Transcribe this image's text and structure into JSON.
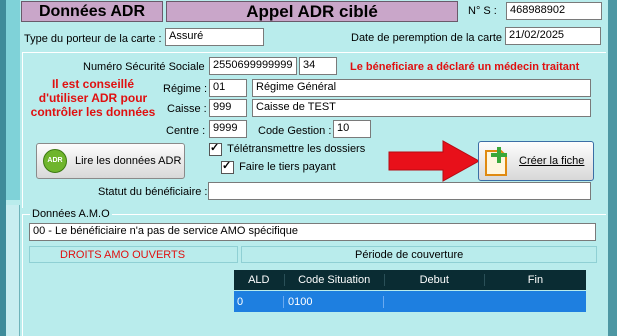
{
  "header": {
    "title_left": "Données ADR",
    "title_center": "Appel ADR ciblé",
    "ns_label": "N° S :",
    "ns_value": "468988902"
  },
  "card": {
    "type_label": "Type du porteur de la carte :",
    "type_value": "Assuré",
    "date_label": "Date de peremption de la carte :",
    "date_value": "21/02/2025"
  },
  "advice": "Il est conseillé d'utiliser ADR pour contrôler les données",
  "secu": {
    "label": "Numéro Sécurité Sociale",
    "value": "2550699999999",
    "key": "34",
    "notice": "Le béneficiare a déclaré un médecin traitant"
  },
  "regime": {
    "label": "Régime :",
    "code": "01",
    "name": "Régime Général"
  },
  "caisse": {
    "label": "Caisse :",
    "code": "999",
    "name": "Caisse de TEST"
  },
  "centre": {
    "label": "Centre :",
    "code": "9999",
    "gestion_label": "Code Gestion :",
    "gestion_value": "10"
  },
  "buttons": {
    "read_adr": "Lire les données ADR",
    "create": "Créer la fiche"
  },
  "checkboxes": {
    "teletransmit": "Télétransmettre les dossiers",
    "tiers_payant": "Faire le tiers payant"
  },
  "statut": {
    "label": "Statut du bénéficiaire :",
    "value": ""
  },
  "amo": {
    "section_label": "Données A.M.O",
    "service_value": "00 - Le bénéficiaire n'a pas de service AMO spécifique",
    "droits": "DROITS AMO OUVERTS",
    "periode": "Période de couverture",
    "columns": [
      "ALD",
      "Code Situation",
      "Debut",
      "Fin"
    ],
    "rows": [
      [
        "0",
        "0100",
        "",
        ""
      ]
    ]
  },
  "colors": {
    "header_bg": "#c9a6c9",
    "panel_bg": "#b9ecec",
    "selection": "#1e7fe0",
    "warning_red": "#e01010",
    "arrow_red": "#e8101a",
    "table_header": "#0a2c33"
  }
}
